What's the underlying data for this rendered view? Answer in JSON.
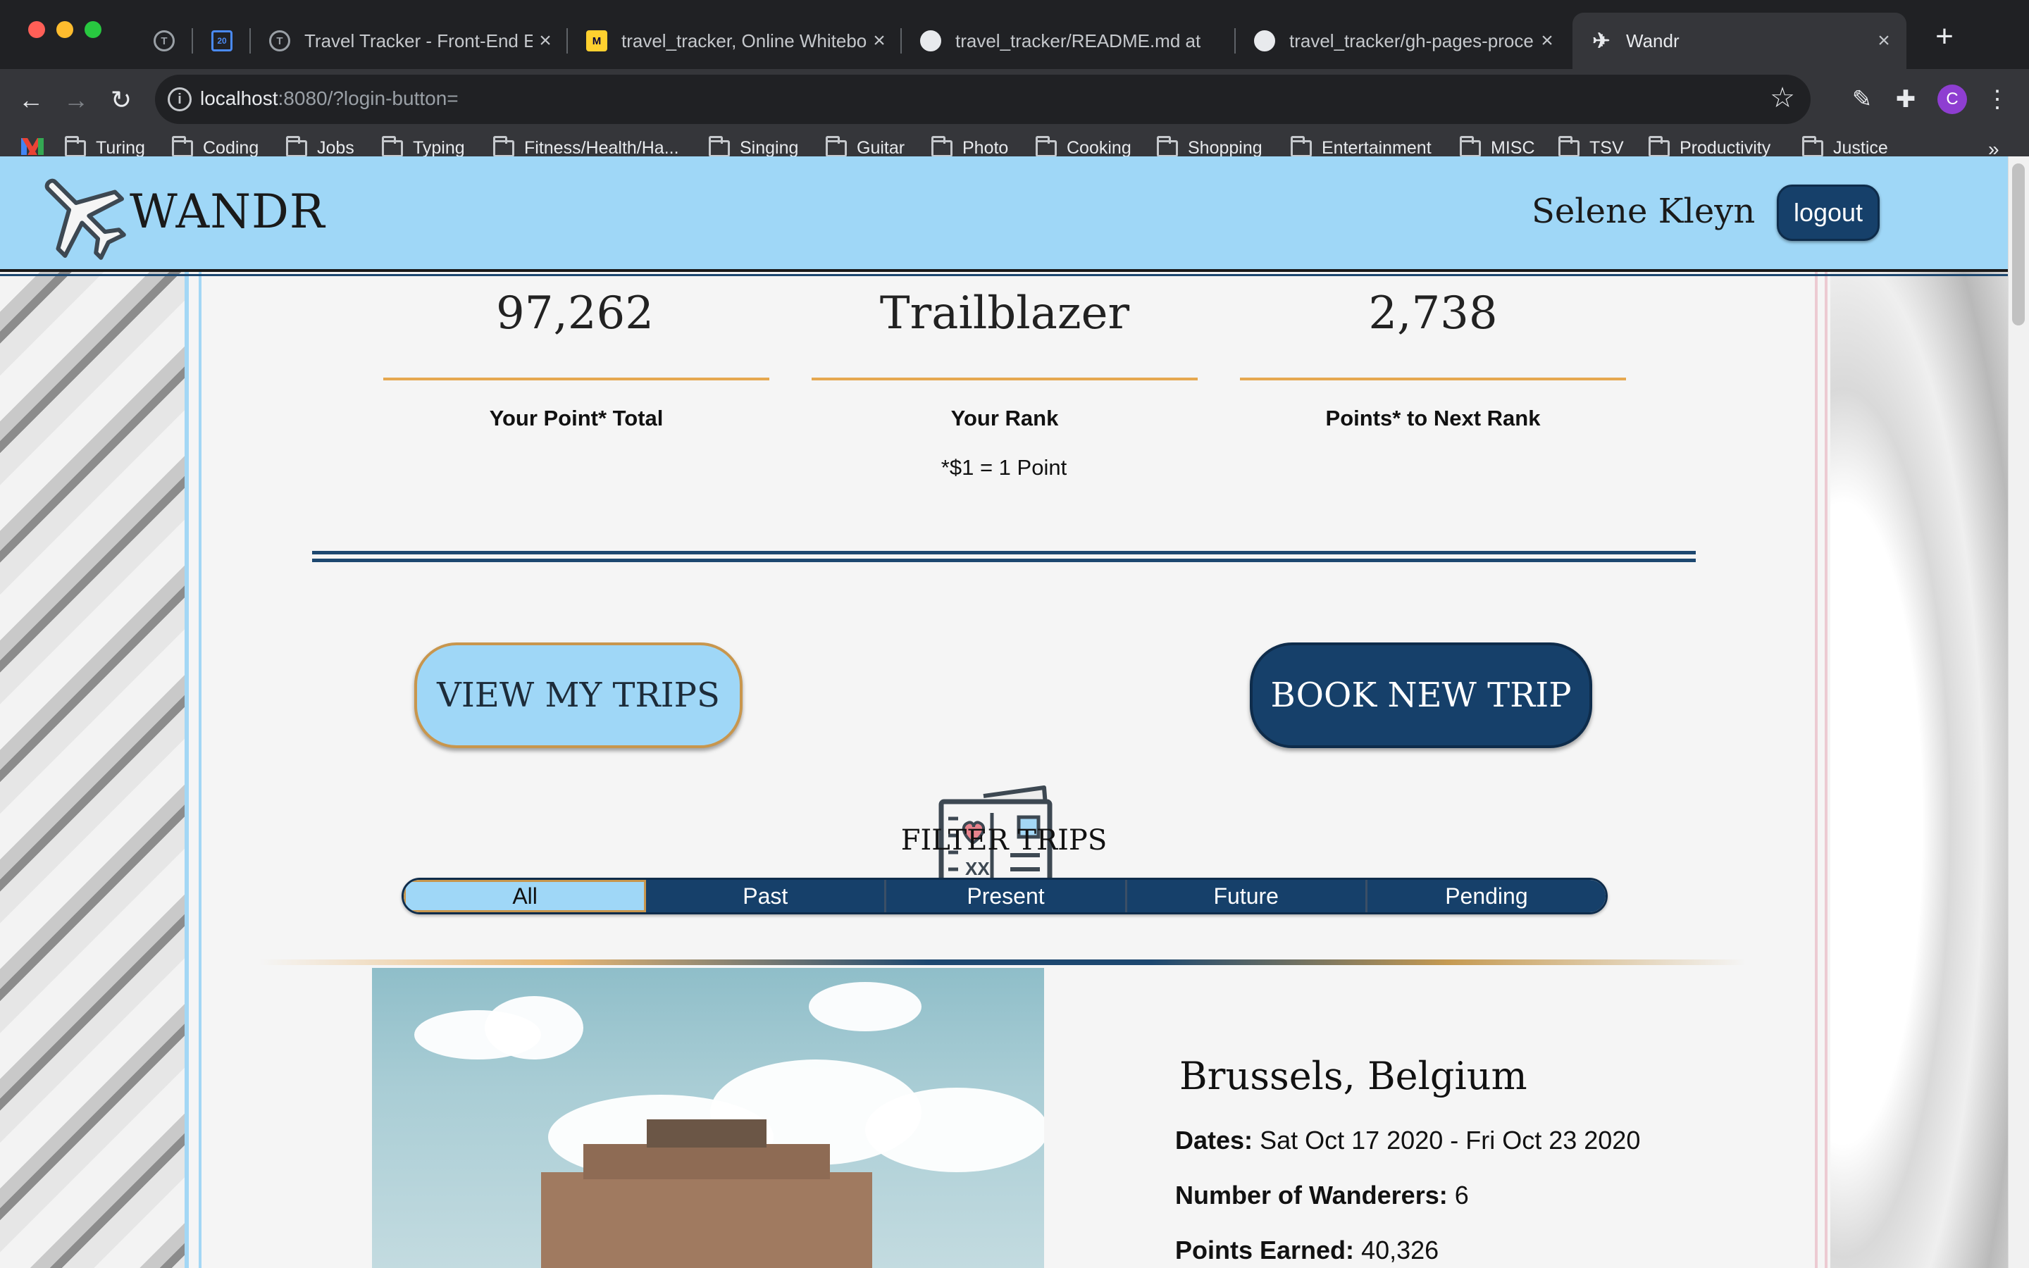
{
  "browser": {
    "tabs": [
      {
        "title": ""
      },
      {
        "title": ""
      },
      {
        "title": "Travel Tracker - Front-End Eng"
      },
      {
        "title": "travel_tracker, Online Whitebo"
      },
      {
        "title": "travel_tracker/README.md at"
      },
      {
        "title": "travel_tracker/gh-pages-proce"
      },
      {
        "title": "Wandr"
      }
    ],
    "url_host": "localhost",
    "url_rest": ":8080/?login-button=",
    "profile_initial": "C",
    "bookmarks": [
      "Turing",
      "Coding",
      "Jobs",
      "Typing",
      "Fitness/Health/Ha...",
      "Singing",
      "Guitar",
      "Photo",
      "Cooking",
      "Shopping",
      "Entertainment",
      "MISC",
      "TSV",
      "Productivity",
      "Justice"
    ],
    "calendar_day": "20"
  },
  "header": {
    "logo": "WANDR",
    "user_name": "Selene Kleyn",
    "logout_label": "logout"
  },
  "stats": {
    "point_total": "97,262",
    "point_total_label": "Your Point* Total",
    "rank": "Trailblazer",
    "rank_label": "Your Rank",
    "to_next": "2,738",
    "to_next_label": "Points* to Next Rank",
    "note": "*$1 = 1 Point"
  },
  "actions": {
    "view_trips": "VIEW MY TRIPS",
    "book_trip": "BOOK NEW TRIP",
    "postcard_text": "XX"
  },
  "filter": {
    "title": "FILTER TRIPS",
    "options": [
      "All",
      "Past",
      "Present",
      "Future",
      "Pending"
    ],
    "selected": "All"
  },
  "trip": {
    "destination": "Brussels, Belgium",
    "dates_label": "Dates:",
    "dates": "Sat Oct 17 2020 - Fri Oct 23 2020",
    "wanderers_label": "Number of Wanderers:",
    "wanderers": "6",
    "points_label": "Points Earned:",
    "points": "40,326"
  },
  "colors": {
    "header_bg": "#9fd7f7",
    "navy": "#16406a",
    "gold": "#e6a84f"
  }
}
